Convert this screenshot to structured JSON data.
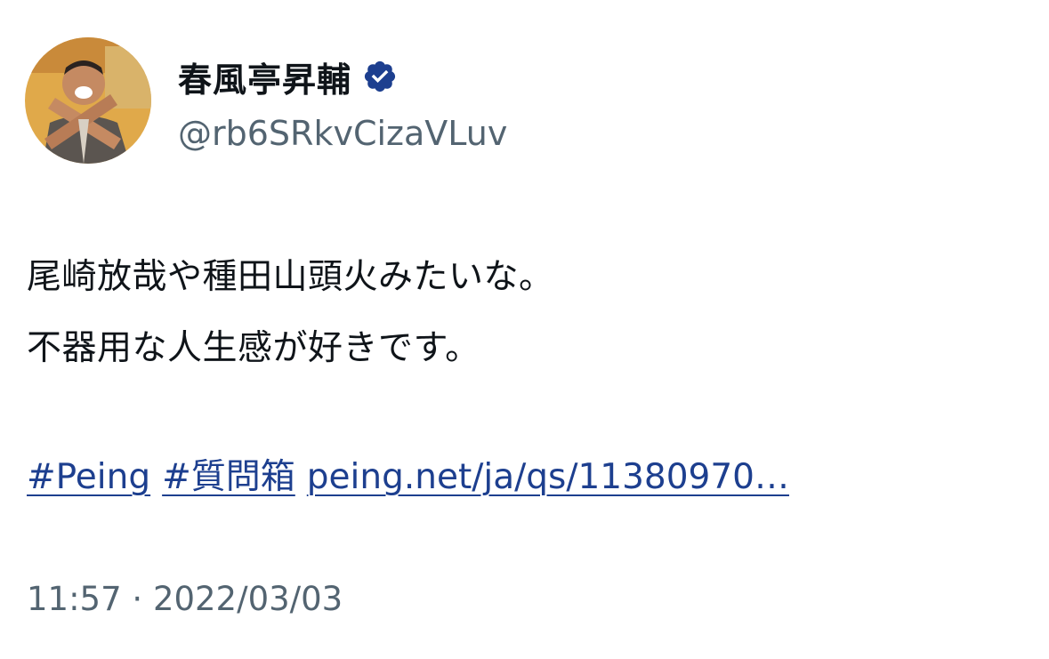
{
  "author": {
    "display_name": "春風亭昇輔",
    "handle": "@rb6SRkvCizaVLuv",
    "verified_icon": "verified-badge-icon",
    "avatar_icon": "avatar-photo"
  },
  "tweet": {
    "lines": [
      "尾崎放哉や種田山頭火みたいな。",
      "不器用な人生感が好きです。"
    ],
    "links": [
      "#Peing",
      "#質問箱",
      "peing.net/ja/qs/11380970…"
    ],
    "time": "11:57",
    "separator": "·",
    "date": "2022/03/03"
  },
  "colors": {
    "text": "#0f1419",
    "secondary": "#536471",
    "link": "#1d3f8f",
    "badge": "#1d3f8f"
  }
}
